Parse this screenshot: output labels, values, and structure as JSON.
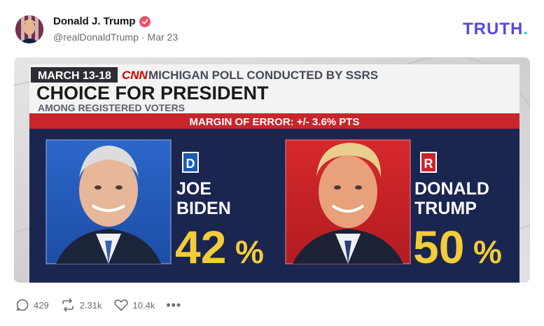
{
  "author": {
    "name": "Donald J. Trump",
    "handle": "@realDonaldTrump",
    "separator": "·",
    "date": "Mar 23"
  },
  "brand": {
    "name": "TRUTH",
    "dot": "."
  },
  "media": {
    "dates": "MARCH 13-18",
    "network": "CNN",
    "subtitle": "MICHIGAN POLL CONDUCTED BY SSRS",
    "title": "CHOICE FOR PRESIDENT",
    "population": "AMONG REGISTERED VOTERS",
    "margin": "MARGIN OF ERROR: +/- 3.6% PTS",
    "candidates": [
      {
        "party": "D",
        "first": "JOE",
        "last": "BIDEN",
        "value": "42",
        "pct": "%",
        "party_color": "#1c5bb3"
      },
      {
        "party": "R",
        "first": "DONALD",
        "last": "TRUMP",
        "value": "50",
        "pct": "%",
        "party_color": "#c8262b"
      }
    ]
  },
  "actions": {
    "replies": "429",
    "retruths": "2.31k",
    "likes": "10.4k",
    "more": "•••"
  },
  "colors": {
    "brand": "#5448ee",
    "brand_dot": "#27d7c0",
    "verified": "#e8506a",
    "panel_navy": "#1a2550",
    "banner_red": "#c8262b",
    "percent_yellow": "#f2cc3a"
  }
}
